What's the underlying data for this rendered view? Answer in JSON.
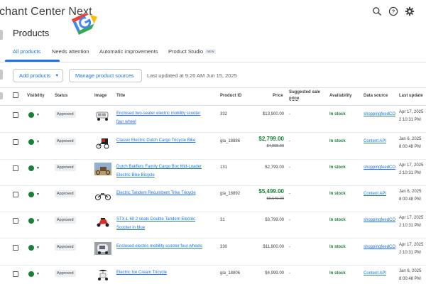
{
  "app": {
    "title": "chant Center Next"
  },
  "header": {
    "page_title": "Products"
  },
  "tabs": [
    {
      "label": "All products"
    },
    {
      "label": "Needs attention"
    },
    {
      "label": "Automatic improvements"
    },
    {
      "label": "Product Studio",
      "badge": "NEW"
    }
  ],
  "toolbar": {
    "add_products": "Add products",
    "manage_sources": "Manage product sources",
    "last_updated": "Last updated at 9:20 AM Jun 15, 2025"
  },
  "table": {
    "columns": {
      "visibility": "Visibility",
      "status": "Status",
      "image": "Image",
      "title": "Title",
      "product_id": "Product ID",
      "price": "Price",
      "suggested_sale_price_1": "Suggested sale",
      "suggested_sale_price_2": "price",
      "availability": "Availability",
      "data_source": "Data source",
      "last_update": "Last update"
    },
    "rows": [
      {
        "status": "Approved",
        "image_icon": "scooter-image",
        "title_1": "Enclosed two-seater electric mobility scooter",
        "title_2": "four wheel",
        "product_id": "332",
        "price": "$13,900.00",
        "sale_price": "",
        "original_price": "",
        "suggested": "-",
        "availability": "In stock",
        "source": "shoppingfeedCO",
        "date": "Apr 17, 2025",
        "time": "2:10:31 PM"
      },
      {
        "status": "Approved",
        "image_icon": "tricycle-image",
        "title_1": "Classic Electric Dutch Cargo Tricycle Bike",
        "title_2": "",
        "product_id": "gla_18886",
        "price": "",
        "sale_price": "$2,799.00",
        "original_price": "$4,965.00",
        "suggested": "-",
        "availability": "In stock",
        "source": "Content API",
        "date": "Jan 6, 2025",
        "time": "8:00:48 PM"
      },
      {
        "status": "Approved",
        "image_icon": "cargo-bike-image",
        "title_1": "Dutch Bakfiets Family Cargo Box Mid-Loader",
        "title_2": "Electric Bike Bicycle",
        "product_id": "131",
        "price": "$2,799.00",
        "sale_price": "",
        "original_price": "",
        "suggested": "-",
        "availability": "In stock",
        "source": "shoppingfeedCO",
        "date": "Apr 17, 2025",
        "time": "2:10:31 PM"
      },
      {
        "status": "Approved",
        "image_icon": "recumbent-trike-image",
        "title_1": "Electric Tandem Recumbent Trike Tricycle",
        "title_2": "",
        "product_id": "gla_18892",
        "price": "",
        "sale_price": "$5,499.00",
        "original_price": "$9,649.00",
        "suggested": "-",
        "availability": "In stock",
        "source": "Content API",
        "date": "Jan 6, 2025",
        "time": "8:00:48 PM"
      },
      {
        "status": "Approved",
        "image_icon": "red-scooter-image",
        "title_1": "STX-L 60 2 seats Double Tandem Electric",
        "title_2": "Scooter in blue",
        "product_id": "31",
        "price": "$3,799.00",
        "sale_price": "",
        "original_price": "",
        "suggested": "-",
        "availability": "In stock",
        "source": "shoppingfeedCO",
        "date": "Apr 17, 2025",
        "time": "2:10:31 PM"
      },
      {
        "status": "Approved",
        "image_icon": "mobility-scooter-image",
        "title_1": "Enclosed electric mobility scooter four wheels",
        "title_2": "",
        "product_id": "330",
        "price": "$11,900.00",
        "sale_price": "",
        "original_price": "",
        "suggested": "-",
        "availability": "In stock",
        "source": "shoppingfeedCO",
        "date": "Apr 17, 2025",
        "time": "2:10:31 PM"
      },
      {
        "status": "Approved",
        "image_icon": "ice-cream-tricycle-image",
        "title_1": "Electric Ice Cream Tricycle",
        "title_2": "",
        "product_id": "gla_18806",
        "price": "$4,999.00",
        "sale_price": "",
        "original_price": "",
        "suggested": "-",
        "availability": "In stock",
        "source": "Content API",
        "date": "Jan 6, 2025",
        "time": "8:00:48 PM"
      }
    ]
  },
  "colors": {
    "accent": "#1a73e8",
    "in_stock": "#188038",
    "sale": "#188038"
  }
}
